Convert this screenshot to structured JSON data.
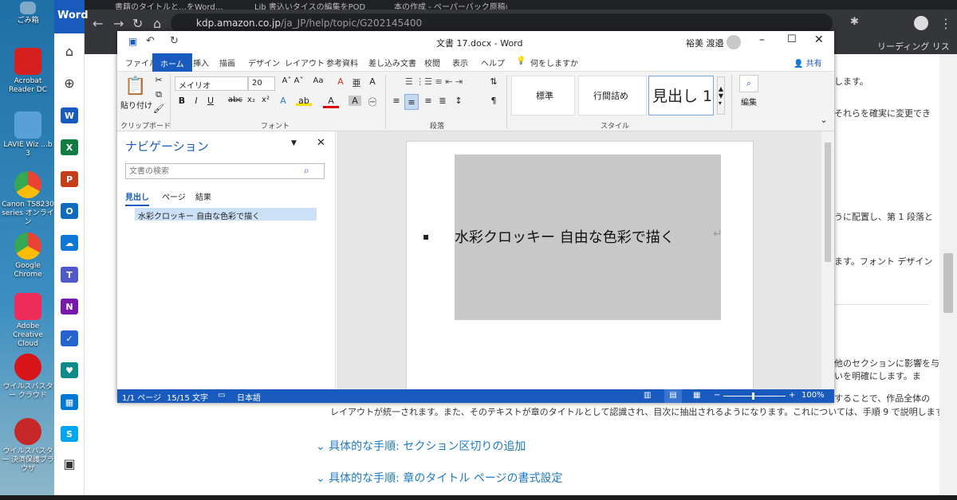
{
  "desktop": {
    "icons": [
      {
        "label": "ごみ箱",
        "color": "#7fa9c9"
      },
      {
        "label": "Acrobat Reader DC",
        "color": "#d5201f"
      },
      {
        "label": "LAVIE Wiz ...b 3",
        "color": "#5aa0d8"
      },
      {
        "label": "Canon TS8230 series オンライン",
        "color": "#ea4335"
      },
      {
        "label": "Google Chrome",
        "color": "#34a853"
      },
      {
        "label": "Adobe Creative Cloud",
        "color": "#ed2c5a"
      },
      {
        "label": "ウイルスバスター クラウド",
        "color": "#d7141a"
      },
      {
        "label": "ウイルスバスター 決済保護ブラウザ",
        "color": "#c62828"
      }
    ]
  },
  "launcher": {
    "title": "Word",
    "home_icon": "home-icon",
    "new_icon": "plus-circle-icon",
    "apps": [
      {
        "letter": "W",
        "color": "#185abd"
      },
      {
        "letter": "X",
        "color": "#107c41"
      },
      {
        "letter": "P",
        "color": "#c43e1c"
      },
      {
        "letter": "O",
        "color": "#0f6cbd"
      },
      {
        "letter": "☁",
        "color": "#0f78d4"
      },
      {
        "letter": "T",
        "color": "#5059c9"
      },
      {
        "letter": "N",
        "color": "#7719aa"
      },
      {
        "letter": "✓",
        "color": "#2564cf"
      },
      {
        "letter": "♥",
        "color": "#0f8a8a"
      },
      {
        "letter": "▦",
        "color": "#0078d4"
      },
      {
        "letter": "S",
        "color": "#00a4ef"
      }
    ]
  },
  "browser": {
    "tabs": [
      "書籍のタイトルと…をWord…",
      "Lib 書込いタイスの編集をPOD（ブー",
      "本の作成 - ペーパーバック原稿の書"
    ],
    "url_host": "kdp.amazon.co.jp",
    "url_path": "/ja_JP/help/topic/G202145400",
    "reading_list": "リーディング リスト",
    "page_lines": [
      "します。",
      "それらを確実に変更でき",
      "うに配置し、第 1 段落と",
      "ます。フォント デザイン",
      "他のセクションに影響を与",
      "いを明確にします。ま",
      "することで、作品全体の",
      "レイアウトが統一されます。また、そのテキストが章のタイトルとして認識され、目次に抽出されるようになります。これについては、手順 9 で説明します。"
    ],
    "links": [
      "具体的な手順: セクション区切りの追加",
      "具体的な手順: 章のタイトル ページの書式設定"
    ]
  },
  "word": {
    "title": "文書 17.docx  -  Word",
    "user": "裕美 渡邉",
    "tabs": [
      "ファイル",
      "ホーム",
      "挿入",
      "描画",
      "デザイン",
      "レイアウト",
      "参考資料",
      "差し込み文書",
      "校閲",
      "表示",
      "ヘルプ",
      "何をしますか"
    ],
    "share": "共有",
    "paste_label": "貼り付け",
    "font_name": "メイリオ",
    "font_size": "20",
    "groups": [
      "クリップボード",
      "フォント",
      "段落",
      "スタイル"
    ],
    "styles": [
      "標準",
      "行間詰め",
      "見出し 1"
    ],
    "edit_label": "編集",
    "nav": {
      "title": "ナビゲーション",
      "search_placeholder": "文書の検索",
      "tabs": [
        "見出し",
        "ページ",
        "結果"
      ],
      "heading_item": "水彩クロッキー 自由な色彩で描く"
    },
    "doc_heading": "水彩クロッキー  自由な色彩で描く",
    "status": {
      "page": "1/1 ページ",
      "chars": "15/15 文字",
      "lang": "日本語",
      "zoom": "100%"
    }
  }
}
